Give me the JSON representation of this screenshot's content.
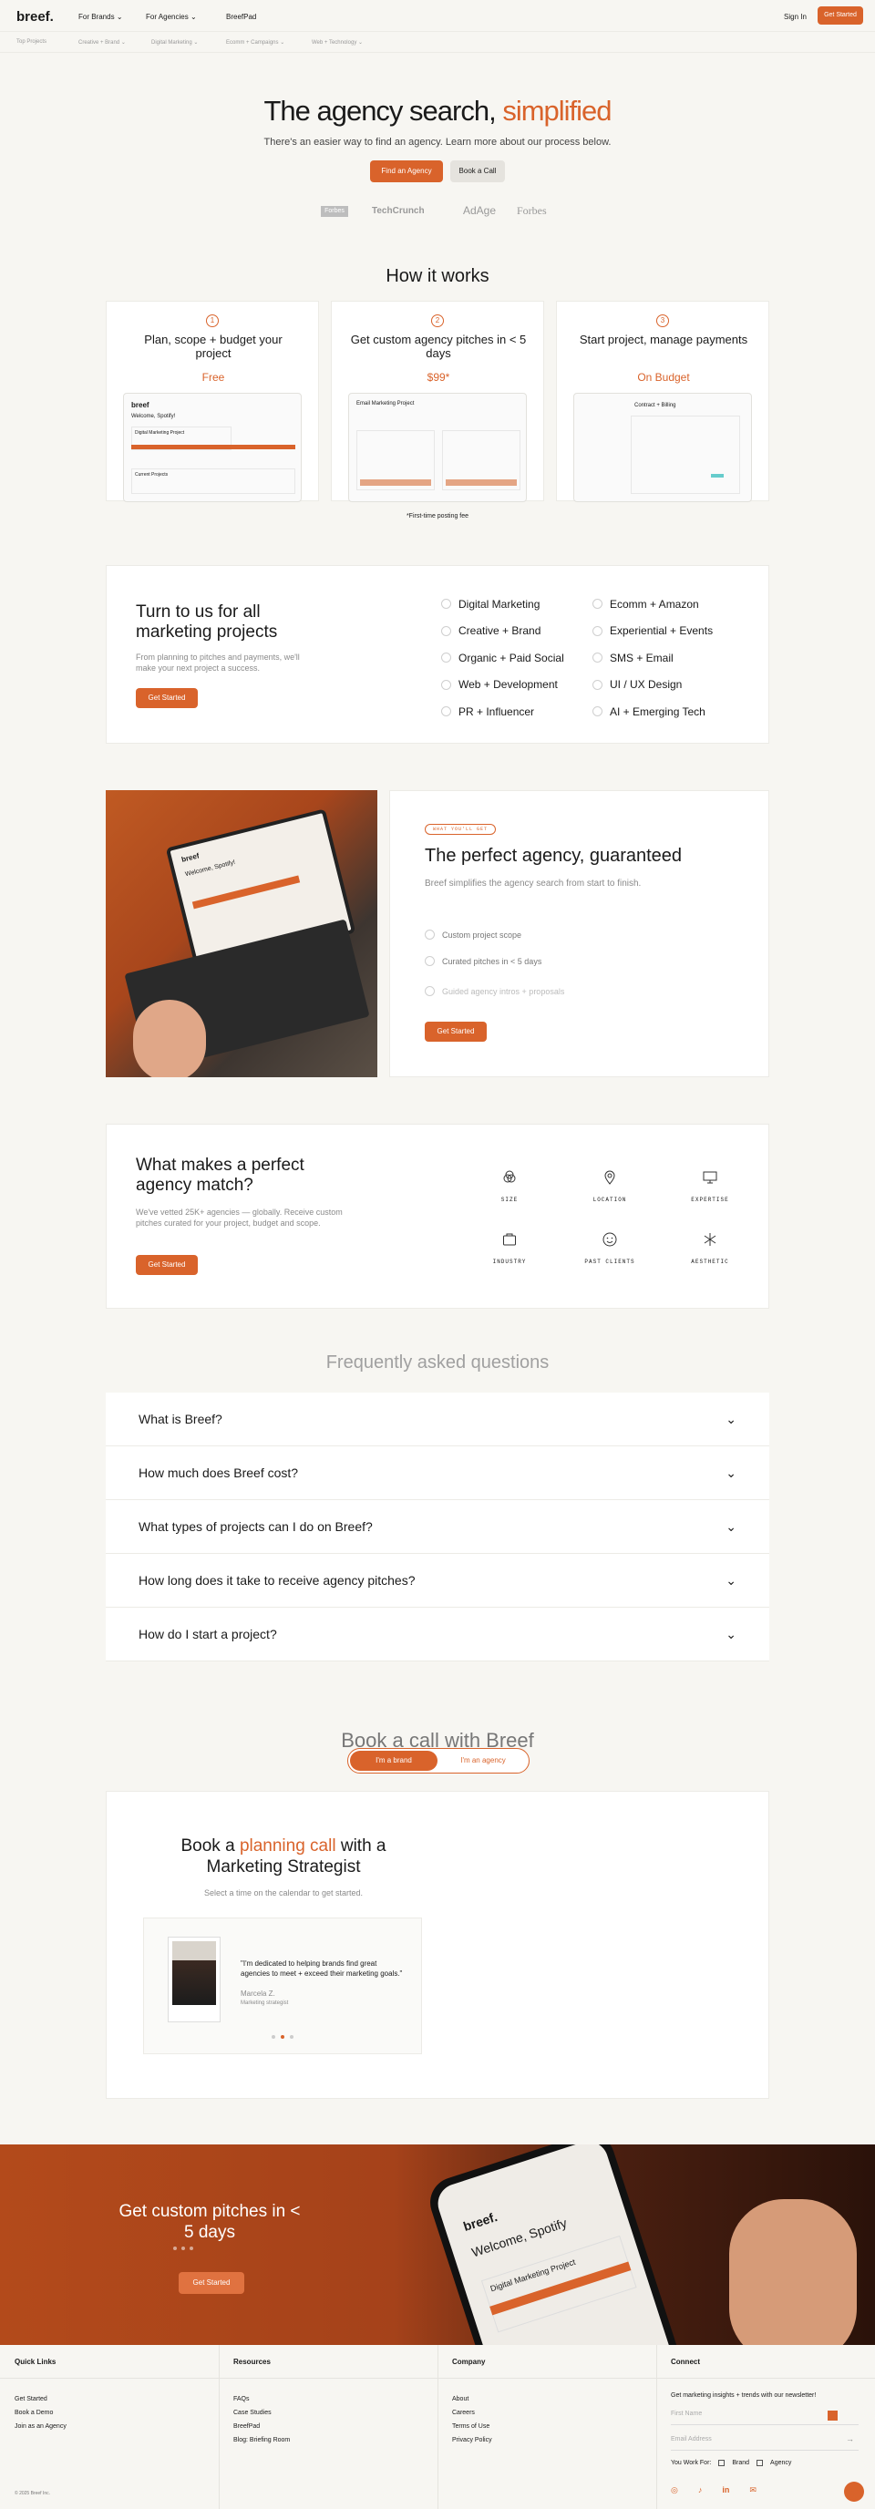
{
  "nav": {
    "logo": "breef.",
    "items": [
      "For Brands",
      "For Agencies",
      "BreefPad"
    ],
    "sign_in": "Sign In",
    "get_started": "Get Started",
    "sub": [
      "Top Projects",
      "Creative + Brand",
      "Digital Marketing",
      "Ecomm + Campaigns",
      "Web + Technology"
    ]
  },
  "hero": {
    "title_a": "The agency search, ",
    "title_b": "simplified",
    "subtitle": "There's an easier way to find an agency. Learn more about our process below.",
    "btn_find": "Find an Agency",
    "btn_call": "Book a Call",
    "logos": [
      "Forbes",
      "TechCrunch",
      "AdAge",
      "Forbes"
    ]
  },
  "how": {
    "title": "How it works",
    "steps": [
      {
        "num": "1",
        "title": "Plan, scope + budget your project",
        "price": "Free"
      },
      {
        "num": "2",
        "title": "Get custom agency pitches in < 5 days",
        "price": "$99*"
      },
      {
        "num": "3",
        "title": "Start project, manage payments",
        "price": "On Budget"
      }
    ],
    "mock1": {
      "logo": "breef",
      "welcome": "Welcome, Spotify!",
      "project": "Digital Marketing Project",
      "current": "Current Projects"
    },
    "mock2": {
      "title": "Email Marketing Project"
    },
    "mock3": {
      "title": "Contract + Billing"
    },
    "footnote": "*First-time posting fee"
  },
  "projects": {
    "title": "Turn to us for all marketing projects",
    "desc": "From planning to pitches and payments, we'll make your next project a success.",
    "btn": "Get Started",
    "col1": [
      "Digital Marketing",
      "Creative + Brand",
      "Organic + Paid Social",
      "Web + Development",
      "PR + Influencer"
    ],
    "col2": [
      "Ecomm + Amazon",
      "Experiential + Events",
      "SMS + Email",
      "UI / UX Design",
      "AI + Emerging Tech"
    ]
  },
  "guarantee": {
    "badge": "WHAT YOU'LL GET",
    "title": "The perfect agency, guaranteed",
    "desc": "Breef simplifies the agency search from start to finish.",
    "items": [
      "Custom project scope",
      "Curated pitches in < 5 days",
      "Guided agency intros + proposals"
    ],
    "btn": "Get Started",
    "laptop_logo": "breef",
    "laptop_welcome": "Welcome, Spotify!"
  },
  "match": {
    "title": "What makes a perfect agency match?",
    "desc": "We've vetted 25K+ agencies — globally. Receive custom pitches curated for your project, budget and scope.",
    "btn": "Get Started",
    "criteria": [
      {
        "icon": "size-icon",
        "label": "SIZE"
      },
      {
        "icon": "location-icon",
        "label": "LOCATION"
      },
      {
        "icon": "expertise-icon",
        "label": "EXPERTISE"
      },
      {
        "icon": "industry-icon",
        "label": "INDUSTRY"
      },
      {
        "icon": "past-clients-icon",
        "label": "PAST CLIENTS"
      },
      {
        "icon": "aesthetic-icon",
        "label": "AESTHETIC"
      }
    ]
  },
  "faq": {
    "title": "Frequently asked questions",
    "items": [
      "What is Breef?",
      "How much does Breef cost?",
      "What types of projects can I do on Breef?",
      "How long does it take to receive agency pitches?",
      "How do I start a project?"
    ]
  },
  "book": {
    "title": "Book a call with Breef",
    "toggle": [
      "I'm a brand",
      "I'm an agency"
    ],
    "card_title_a": "Book a ",
    "card_title_b": "planning call",
    "card_title_c": " with a Marketing Strategist",
    "card_sub": "Select a time on the calendar to get started.",
    "quote": "\"I'm dedicated to helping brands find great agencies to meet + exceed their marketing goals.\"",
    "name": "Marcela Z.",
    "role": "Marketing strategist"
  },
  "cta": {
    "title": "Get custom pitches in < 5 days",
    "btn": "Get Started",
    "phone_logo": "breef.",
    "phone_welcome": "Welcome, Spotify",
    "phone_project": "Digital Marketing Project"
  },
  "footer": {
    "quick": {
      "title": "Quick Links",
      "items": [
        "Get Started",
        "Book a Demo",
        "Join as an Agency"
      ]
    },
    "res": {
      "title": "Resources",
      "items": [
        "FAQs",
        "Case Studies",
        "BreefPad",
        "Blog: Briefing Room"
      ]
    },
    "company": {
      "title": "Company",
      "items": [
        "About",
        "Careers",
        "Terms of Use",
        "Privacy Policy"
      ]
    },
    "connect": {
      "title": "Connect",
      "desc": "Get marketing insights + trends with our newsletter!",
      "first": "First Name",
      "email": "Email Address",
      "work": "You Work For:",
      "brand": "Brand",
      "agency": "Agency"
    },
    "copy": "© 2025 Breef Inc."
  }
}
